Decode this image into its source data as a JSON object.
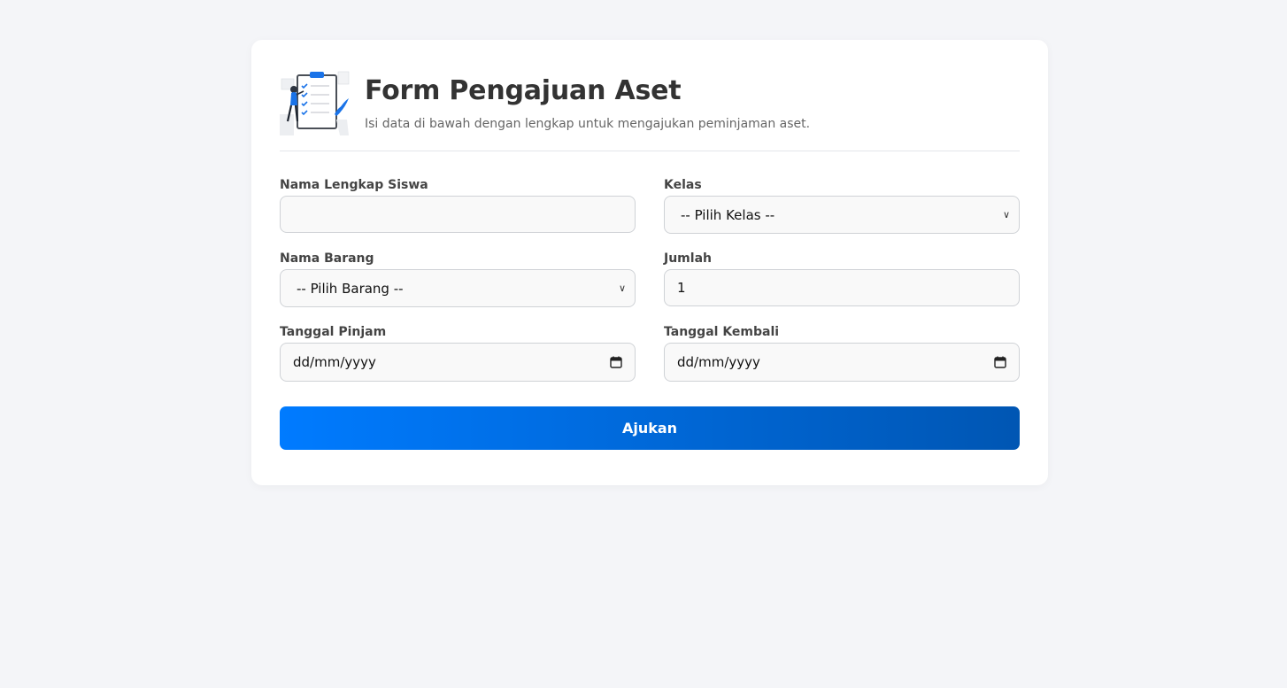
{
  "header": {
    "title": "Form Pengajuan Aset",
    "subtitle": "Isi data di bawah dengan lengkap untuk mengajukan peminjaman aset.",
    "illustration_icon": "clipboard-checklist-icon"
  },
  "form": {
    "nama_siswa": {
      "label": "Nama Lengkap Siswa",
      "value": ""
    },
    "kelas": {
      "label": "Kelas",
      "selected": "-- Pilih Kelas --"
    },
    "nama_barang": {
      "label": "Nama Barang",
      "selected": "-- Pilih Barang --"
    },
    "jumlah": {
      "label": "Jumlah",
      "value": "1"
    },
    "tanggal_pinjam": {
      "label": "Tanggal Pinjam",
      "placeholder": "dd/mm/yyyy"
    },
    "tanggal_kembali": {
      "label": "Tanggal Kembali",
      "placeholder": "dd/mm/yyyy"
    },
    "submit_label": "Ajukan"
  },
  "colors": {
    "background": "#f4f5f8",
    "accent_start": "#007bff",
    "accent_end": "#0056b3"
  }
}
